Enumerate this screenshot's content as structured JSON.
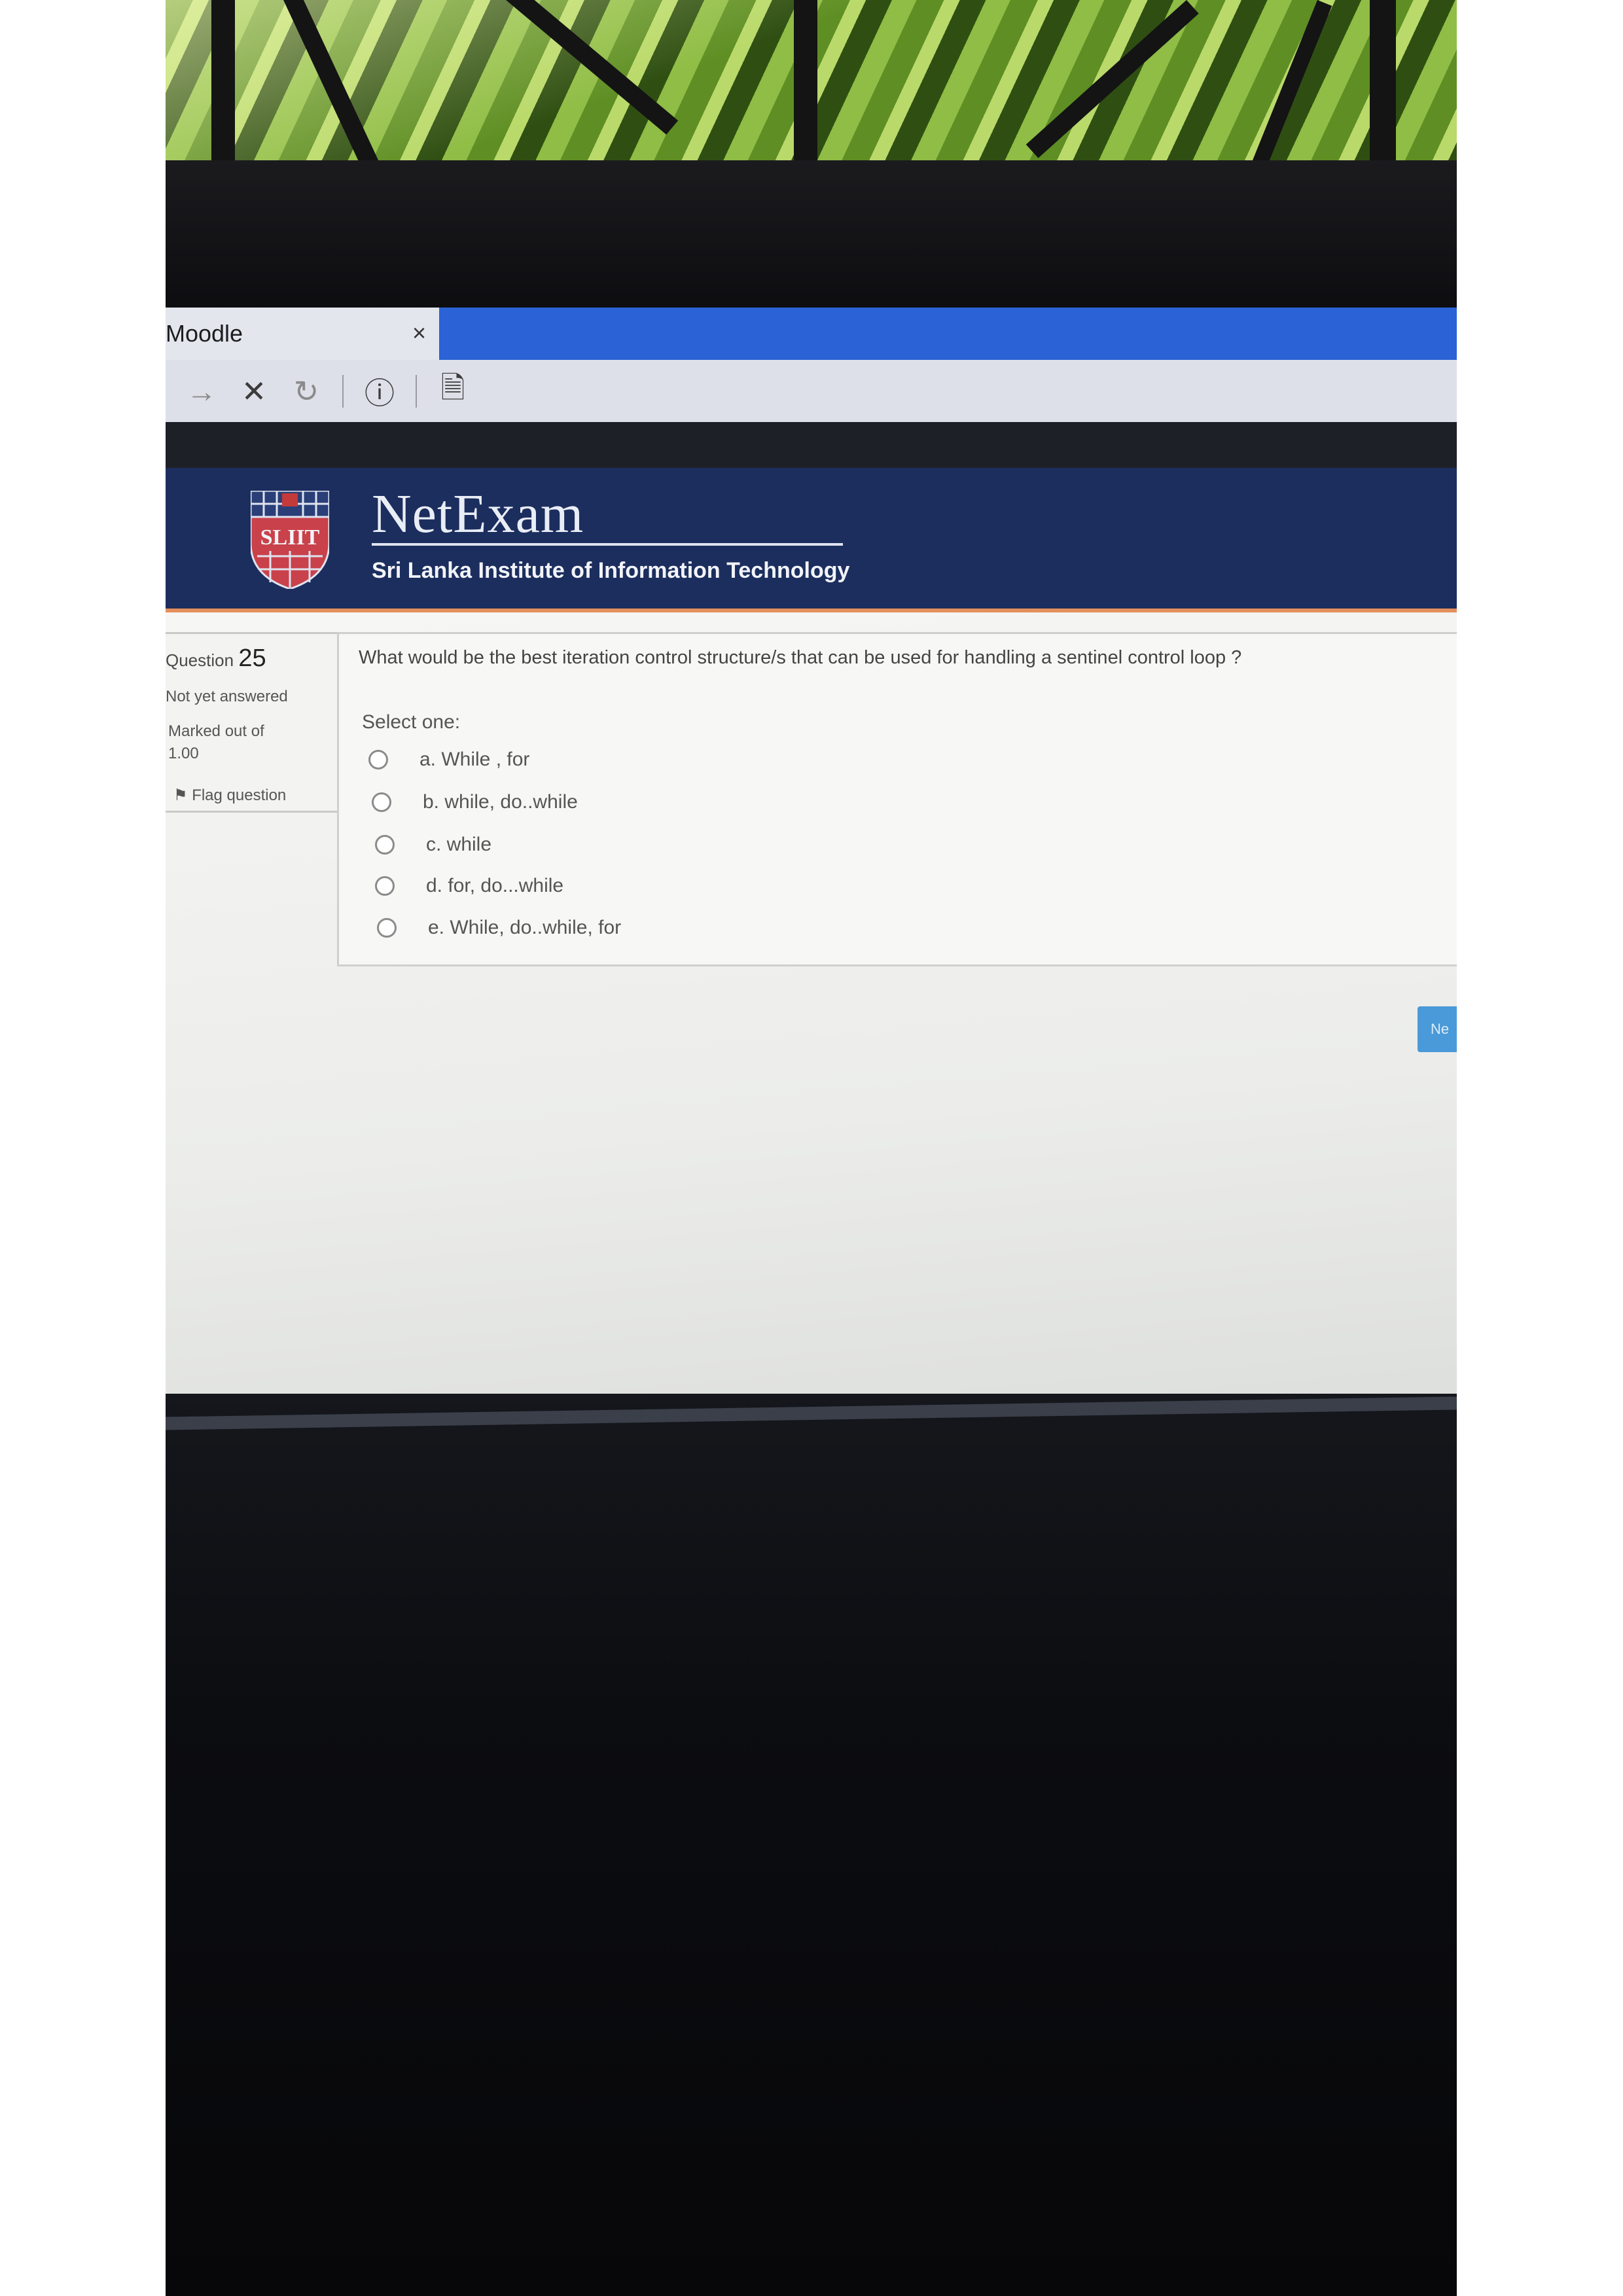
{
  "browser": {
    "tab_title": "Moodle",
    "tab_close": "×",
    "toolbar": {
      "forward_icon": "→",
      "stop_icon": "✕",
      "reload_icon": "↻",
      "info_icon": "ⓘ",
      "page_icon": "🗎"
    }
  },
  "header": {
    "title": "NetExam",
    "subtitle": "Sri Lanka Institute of Information Technology",
    "logo_text": "SLIIT"
  },
  "question_info": {
    "label": "Question",
    "number": "25",
    "state": "Not yet answered",
    "mark": "Marked out of 1.00",
    "flag_label": "Flag question"
  },
  "question": {
    "text": "What would be the best iteration control structure/s that can be used for handling a sentinel control loop ?",
    "prompt": "Select one:",
    "options": [
      {
        "label": "a. While , for"
      },
      {
        "label": "b. while, do..while"
      },
      {
        "label": "c. while"
      },
      {
        "label": "d. for, do...while"
      },
      {
        "label": "e. While, do..while, for"
      }
    ]
  },
  "navigation": {
    "next_label": "Ne"
  },
  "colors": {
    "header_bg": "#1c2e5e",
    "tabstrip": "#2b63d6",
    "accent_line": "#e58f5c",
    "next_button": "#4a9ad9"
  }
}
